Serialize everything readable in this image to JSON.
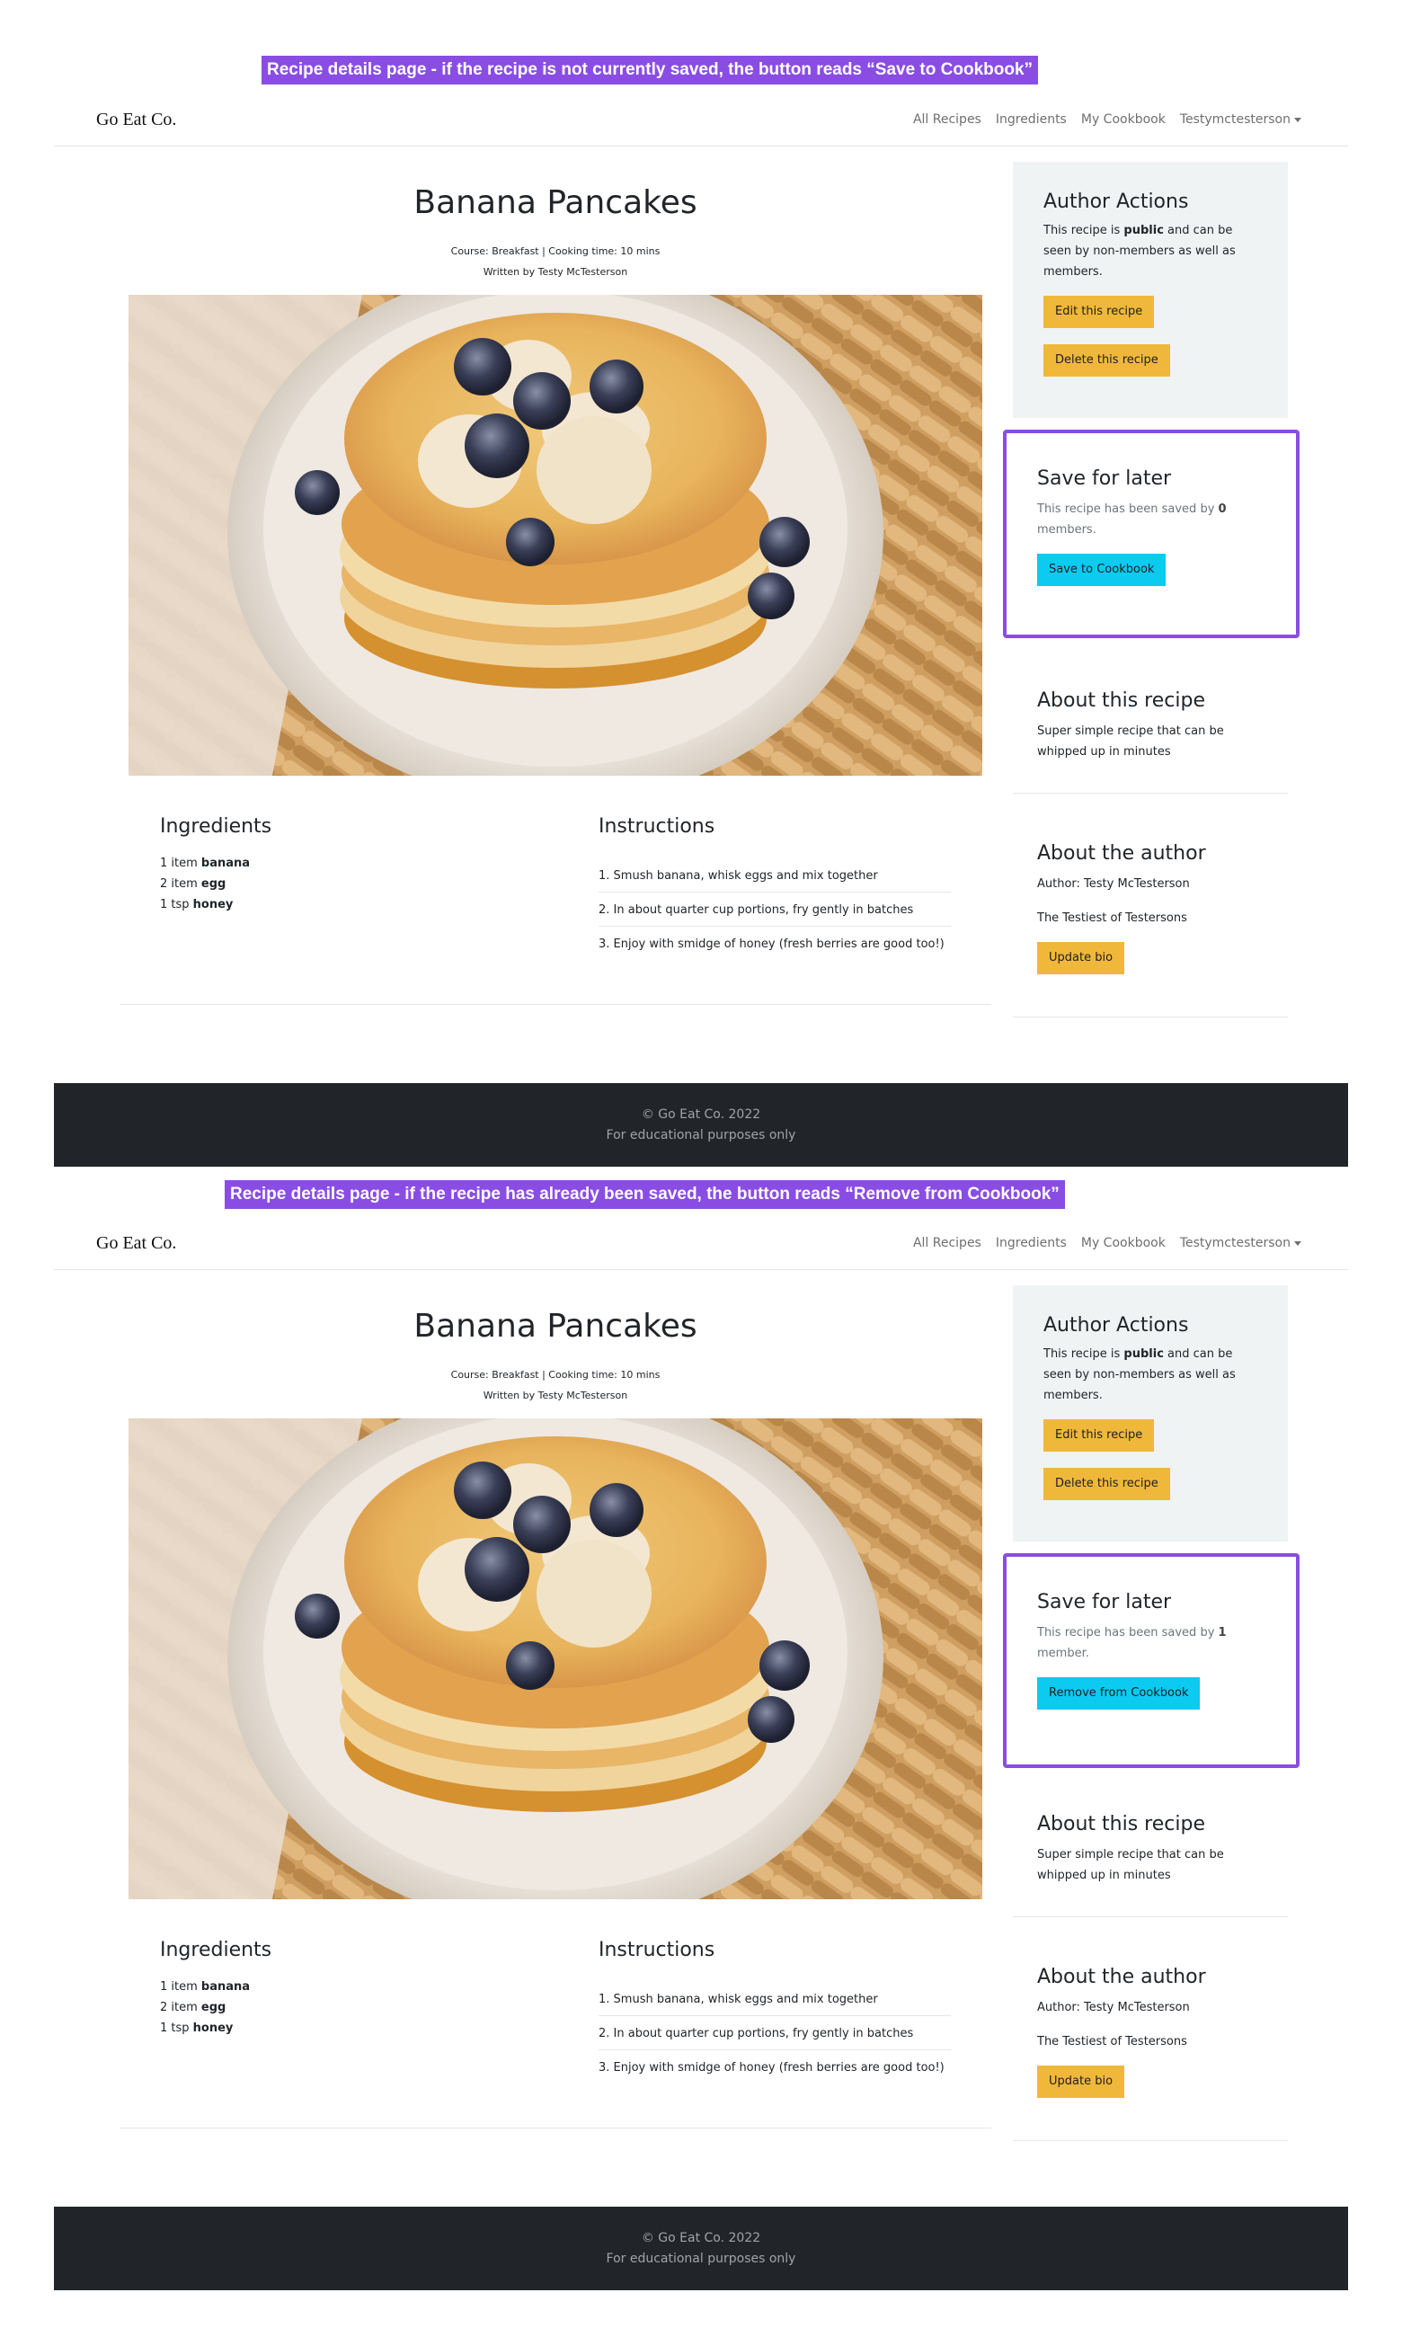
{
  "captions": {
    "top": "Recipe details page - if the recipe is not currently saved, the button reads “Save to Cookbook”",
    "bottom": "Recipe details page - if the recipe has already been saved, the button reads “Remove from Cookbook”"
  },
  "nav": {
    "brand": "Go Eat Co.",
    "links": [
      "All Recipes",
      "Ingredients",
      "My Cookbook",
      "Testymctesterson"
    ]
  },
  "recipe": {
    "title": "Banana Pancakes",
    "course_line": "Course: Breakfast | Cooking time: 10 mins",
    "author_line": "Written by Testy McTesterson",
    "ingredients_heading": "Ingredients",
    "instructions_heading": "Instructions",
    "ingredients": [
      {
        "qty": "1 item",
        "name": "banana"
      },
      {
        "qty": "2 item",
        "name": "egg"
      },
      {
        "qty": "1 tsp",
        "name": "honey"
      }
    ],
    "instructions": [
      "1. Smush banana, whisk eggs and mix together",
      "2. In about quarter cup portions, fry gently in batches",
      "3. Enjoy with smidge of honey (fresh berries are good too!)"
    ]
  },
  "author_actions": {
    "heading": "Author Actions",
    "text_pre": "This recipe is ",
    "text_bold": "public",
    "text_post": " and can be seen by non-members as well as members.",
    "edit_label": "Edit this recipe",
    "delete_label": "Delete this recipe"
  },
  "save_top": {
    "heading": "Save for later",
    "text_pre": "This recipe has been saved by ",
    "count": "0",
    "text_post": " members.",
    "button_label": "Save to Cookbook"
  },
  "save_bottom": {
    "heading": "Save for later",
    "text_pre": "This recipe has been saved by ",
    "count": "1",
    "text_post": " member.",
    "button_label": "Remove from Cookbook"
  },
  "about_recipe": {
    "heading": "About this recipe",
    "text": "Super simple recipe that can be whipped up in minutes"
  },
  "about_author": {
    "heading": "About the author",
    "author": "Author: Testy McTesterson",
    "bio": "The Testiest of Testersons",
    "button_label": "Update bio"
  },
  "footer": {
    "copyright": "© Go Eat Co. 2022",
    "note": "For educational purposes only"
  },
  "colors": {
    "highlight": "#8a4de4",
    "warning_button": "#f0b83a",
    "info_button": "#0dcaf0",
    "footer_bg": "#212529",
    "card_bg": "#f0f3f4"
  }
}
